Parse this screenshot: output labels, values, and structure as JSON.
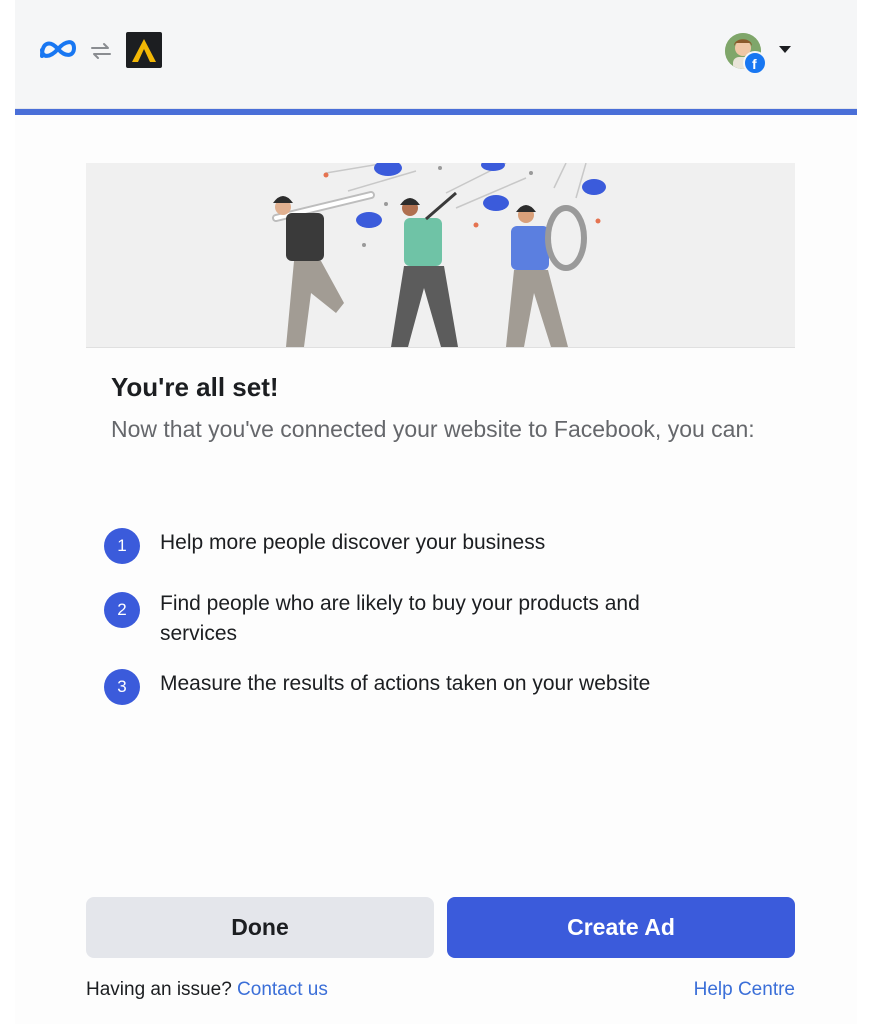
{
  "header": {
    "meta_logo_icon": "meta-logo-icon",
    "sync_icon": "sync-arrows-icon",
    "app_logo_icon": "app-logo-icon",
    "avatar_icon": "user-avatar",
    "badge_icon": "facebook-badge-icon",
    "menu_icon": "caret-down-icon"
  },
  "colors": {
    "accent": "#3b5bdb",
    "link": "#3b6fd8",
    "divider": "#4a6fd8"
  },
  "content": {
    "title": "You're all set!",
    "subtitle": "Now that you've connected your website to Facebook, you can:",
    "steps": [
      {
        "number": "1",
        "text": "Help more people discover your business"
      },
      {
        "number": "2",
        "text": "Find people who are likely to buy your products and services"
      },
      {
        "number": "3",
        "text": "Measure the results of actions taken on your website"
      }
    ]
  },
  "actions": {
    "done_label": "Done",
    "create_label": "Create Ad"
  },
  "footer": {
    "issue_text": "Having an issue? ",
    "contact_label": "Contact us",
    "help_label": "Help Centre"
  }
}
